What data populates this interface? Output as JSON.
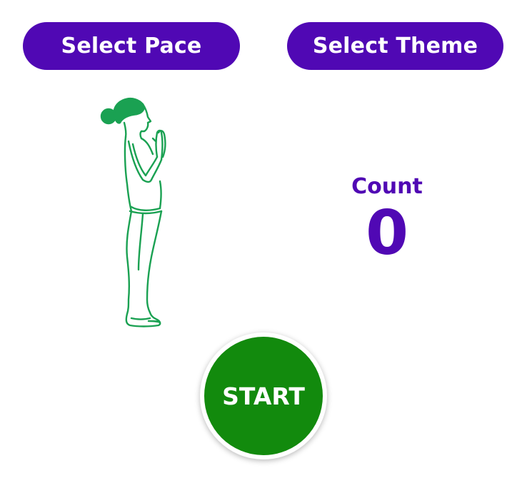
{
  "header": {
    "pace_button_label": "Select Pace",
    "theme_button_label": "Select Theme"
  },
  "illustration": {
    "icon": "standing-prayer-pose-figure",
    "color": "#1aa152"
  },
  "counter": {
    "label": "Count",
    "value": "0"
  },
  "start_button": {
    "label": "START"
  },
  "colors": {
    "accent_purple": "#5008b4",
    "start_green": "#128a0d",
    "background": "#ffffff"
  }
}
